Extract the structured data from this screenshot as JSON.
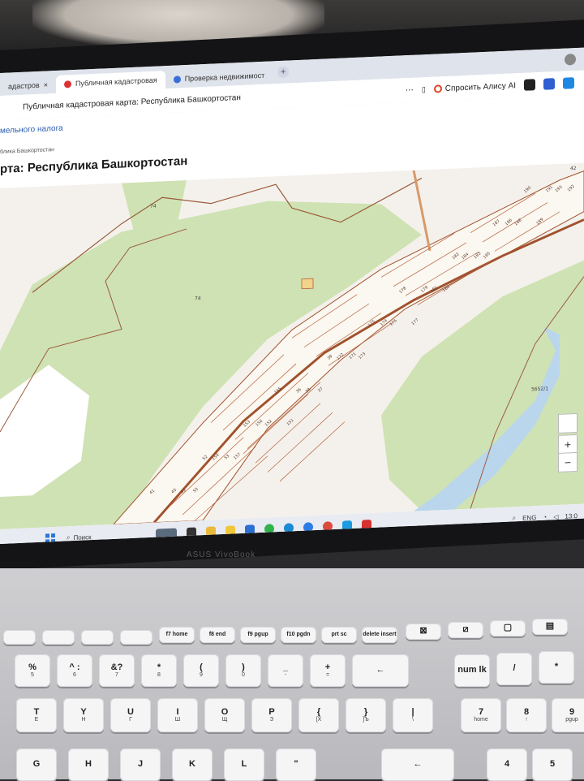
{
  "browser": {
    "tabs": [
      {
        "label": "адастров",
        "close": "×"
      },
      {
        "label": "Публичная кадастровая"
      },
      {
        "label": "Проверка недвижимост"
      }
    ],
    "new_tab": "+",
    "address_title": "Публичная кадастровая карта: Республика Башкортостан",
    "tools": {
      "more": "⋯",
      "bookmark": "🔖",
      "alice": "Спросить Алису AI"
    }
  },
  "page": {
    "tax_link": "мельного налога",
    "breadcrumb": "блика Башкортостан",
    "title": "рта: Республика Башкортостан"
  },
  "map": {
    "labels": {
      "forest_top": "74",
      "forest_mid": "74",
      "water": "5652/1",
      "corner": "42"
    },
    "parcel_numbers": [
      "41",
      "40",
      "50",
      "51",
      "52",
      "53",
      "154",
      "157",
      "156",
      "153",
      "152",
      "151",
      "155",
      "36",
      "37",
      "38",
      "39",
      "171",
      "172",
      "173",
      "174",
      "175",
      "176",
      "177",
      "178",
      "179",
      "180",
      "181",
      "182",
      "183",
      "184",
      "185",
      "186",
      "187",
      "188",
      "189",
      "190",
      "191",
      "192",
      "193"
    ],
    "zoom_in": "+",
    "zoom_out": "−"
  },
  "taskbar": {
    "search": "Поиск",
    "lang": "ENG",
    "time": "13:0"
  },
  "laptop": {
    "brand": "ASUS VivoBook"
  },
  "keyboard": {
    "row1": [
      "f7 home",
      "f8 end",
      "f9 pgup",
      "f10 pgdn",
      "prt sc",
      "delete insert"
    ],
    "row2": [
      {
        "top": "%",
        "bottom": "5"
      },
      {
        "top": "^ :",
        "bottom": "6"
      },
      {
        "top": "&?",
        "bottom": "7"
      },
      {
        "top": "*",
        "bottom": "8"
      },
      {
        "top": "(",
        "bottom": "9"
      },
      {
        "top": ")",
        "bottom": "0"
      },
      {
        "top": "_",
        "bottom": "-"
      },
      {
        "top": "+",
        "bottom": "="
      },
      {
        "top": "←",
        "bottom": ""
      },
      {
        "top": "num lk",
        "bottom": ""
      },
      {
        "top": "/",
        "bottom": ""
      },
      {
        "top": "*",
        "bottom": ""
      }
    ],
    "row3": [
      {
        "top": "T",
        "bottom": "Е"
      },
      {
        "top": "Y",
        "bottom": "Н"
      },
      {
        "top": "U",
        "bottom": "Г"
      },
      {
        "top": "I",
        "bottom": "Ш"
      },
      {
        "top": "O",
        "bottom": "Щ"
      },
      {
        "top": "P",
        "bottom": "З"
      },
      {
        "top": "{",
        "bottom": "[Х"
      },
      {
        "top": "}",
        "bottom": "]Ъ"
      },
      {
        "top": "|",
        "bottom": "\\"
      },
      {
        "top": "7",
        "bottom": "home"
      },
      {
        "top": "8",
        "bottom": "↑"
      },
      {
        "top": "9",
        "bottom": "pgup"
      }
    ],
    "row4": [
      {
        "top": "G",
        "bottom": ""
      },
      {
        "top": "H",
        "bottom": ""
      },
      {
        "top": "J",
        "bottom": ""
      },
      {
        "top": "K",
        "bottom": ""
      },
      {
        "top": "L",
        "bottom": ""
      },
      {
        "top": "\"",
        "bottom": ""
      },
      {
        "top": "←",
        "bottom": ""
      },
      {
        "top": "4",
        "bottom": ""
      },
      {
        "top": "5",
        "bottom": ""
      }
    ]
  }
}
